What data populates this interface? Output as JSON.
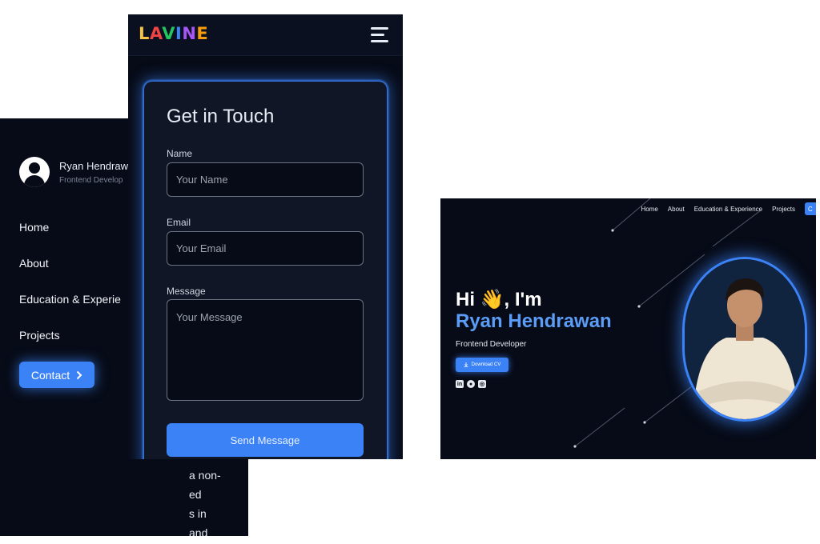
{
  "sidebar": {
    "profile_name": "Ryan Hendrawa",
    "profile_role": "Frontend Develop",
    "nav": [
      "Home",
      "About",
      "Education & Experie",
      "Projects"
    ],
    "contact_label": "Contact",
    "paragraph_lines": [
      "a non-",
      "ed",
      "s in",
      "and"
    ]
  },
  "contact": {
    "logo": [
      "L",
      "A",
      "V",
      "I",
      "N",
      "E"
    ],
    "title": "Get in Touch",
    "name_label": "Name",
    "name_placeholder": "Your Name",
    "email_label": "Email",
    "email_placeholder": "Your Email",
    "message_label": "Message",
    "message_placeholder": "Your Message",
    "send_label": "Send Message"
  },
  "hero": {
    "nav": [
      "Home",
      "About",
      "Education & Experience",
      "Projects"
    ],
    "nav_button": "C",
    "greeting": "Hi 👋, I'm",
    "name": "Ryan Hendrawan",
    "role": "Frontend Developer",
    "cv_label": "Download CV",
    "socials": [
      "linkedin-icon",
      "github-icon",
      "instagram-icon"
    ]
  },
  "colors": {
    "background": "#070b17",
    "accent": "#3b82f6",
    "name_blue": "#5b9cf6"
  }
}
